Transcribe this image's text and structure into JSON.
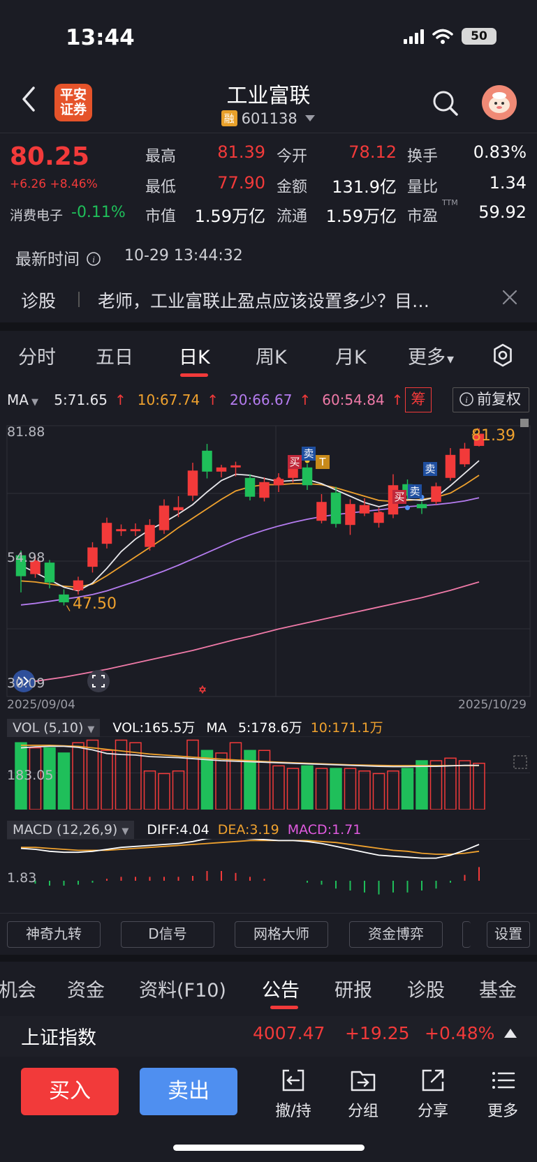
{
  "status_bar": {
    "time": "13:44",
    "battery": "50"
  },
  "header": {
    "broker_logo_text": "平安证券",
    "stock_name": "工业富联",
    "margin_badge": "融",
    "stock_code": "601138"
  },
  "quote": {
    "price": "80.25",
    "change": "+6.26 +8.46%",
    "sector_name": "消费电子",
    "sector_change": "-0.11%",
    "fields": [
      {
        "label": "最高",
        "value": "81.39",
        "color": "#f23a3a"
      },
      {
        "label": "今开",
        "value": "78.12",
        "color": "#f23a3a"
      },
      {
        "label": "换手",
        "value": "0.83%",
        "color": "#ffffff"
      },
      {
        "label": "最低",
        "value": "77.90",
        "color": "#f23a3a"
      },
      {
        "label": "金额",
        "value": "131.9亿",
        "color": "#ffffff"
      },
      {
        "label": "量比",
        "value": "1.34",
        "color": "#ffffff"
      },
      {
        "label": "市值",
        "value": "1.59万亿",
        "color": "#ffffff"
      },
      {
        "label": "流通",
        "value": "1.59万亿",
        "color": "#ffffff"
      },
      {
        "label": "市盈",
        "value": "59.92",
        "color": "#ffffff",
        "superscript": "TTM"
      }
    ],
    "latest_time_label": "最新时间",
    "latest_time": "10-29 13:44:32"
  },
  "diagnosis": {
    "label": "诊股",
    "text": "老师，工业富联止盈点应该设置多少？目…"
  },
  "chart_tabs": [
    "分时",
    "五日",
    "日K",
    "周K",
    "月K",
    "更多"
  ],
  "active_chart_tab": "日K",
  "ma_legend": {
    "ma_label": "MA",
    "items": [
      {
        "text": "5:71.65",
        "color": "#e8e8ec"
      },
      {
        "text": "10:67.74",
        "color": "#f0a22e"
      },
      {
        "text": "20:66.67",
        "color": "#b57cf0"
      },
      {
        "text": "60:54.84",
        "color": "#f07aa8"
      }
    ],
    "chou": "筹",
    "fuquan": "前复权"
  },
  "kline": {
    "y_max_label": "81.88",
    "y_mid_label": "54.98",
    "y_min_label": "30.09",
    "low_marker": "47.50",
    "high_marker": "81.39",
    "date_start": "2025/09/04",
    "date_end": "2025/10/29",
    "signals": [
      {
        "text": "买",
        "color": "#c0283a"
      },
      {
        "text": "卖",
        "color": "#1f4fa0"
      },
      {
        "text": "T",
        "color": "#c88a1a"
      },
      {
        "text": "买",
        "color": "#c0283a"
      },
      {
        "text": "卖",
        "color": "#1f4fa0"
      },
      {
        "text": "卖",
        "color": "#1f4fa0"
      }
    ]
  },
  "chart_data": {
    "type": "candlestick",
    "ylim": [
      30.09,
      81.88
    ],
    "candles": [
      {
        "o": 57.0,
        "c": 53.2,
        "h": 58.0,
        "l": 50.0
      },
      {
        "o": 53.6,
        "c": 56.0,
        "h": 57.0,
        "l": 52.8
      },
      {
        "o": 55.6,
        "c": 52.0,
        "h": 56.2,
        "l": 50.8
      },
      {
        "o": 49.5,
        "c": 48.2,
        "h": 50.6,
        "l": 47.5
      },
      {
        "o": 50.5,
        "c": 52.2,
        "h": 53.0,
        "l": 49.6
      },
      {
        "o": 55.0,
        "c": 58.5,
        "h": 59.6,
        "l": 53.8
      },
      {
        "o": 59.4,
        "c": 63.2,
        "h": 64.3,
        "l": 58.4
      },
      {
        "o": 61.8,
        "c": 62.0,
        "h": 63.0,
        "l": 60.8
      },
      {
        "o": 61.8,
        "c": 62.0,
        "h": 63.2,
        "l": 60.8
      },
      {
        "o": 58.8,
        "c": 62.8,
        "h": 64.0,
        "l": 58.0
      },
      {
        "o": 62.0,
        "c": 66.5,
        "h": 67.8,
        "l": 61.2
      },
      {
        "o": 65.8,
        "c": 66.2,
        "h": 68.4,
        "l": 64.4
      },
      {
        "o": 68.6,
        "c": 73.2,
        "h": 74.8,
        "l": 67.5
      },
      {
        "o": 77.0,
        "c": 73.2,
        "h": 78.4,
        "l": 71.8
      },
      {
        "o": 73.2,
        "c": 73.8,
        "h": 74.4,
        "l": 72.0
      },
      {
        "o": 74.0,
        "c": 74.2,
        "h": 75.0,
        "l": 72.2
      },
      {
        "o": 71.8,
        "c": 68.4,
        "h": 72.6,
        "l": 67.6
      },
      {
        "o": 68.2,
        "c": 71.0,
        "h": 72.0,
        "l": 67.4
      },
      {
        "o": 70.6,
        "c": 71.6,
        "h": 72.8,
        "l": 69.2
      },
      {
        "o": 72.0,
        "c": 74.0,
        "h": 75.8,
        "l": 71.0
      },
      {
        "o": 73.8,
        "c": 70.6,
        "h": 74.6,
        "l": 69.6
      },
      {
        "o": 63.8,
        "c": 67.2,
        "h": 68.8,
        "l": 63.2
      },
      {
        "o": 69.0,
        "c": 63.2,
        "h": 70.2,
        "l": 62.4
      },
      {
        "o": 63.0,
        "c": 66.8,
        "h": 67.8,
        "l": 61.0
      },
      {
        "o": 65.2,
        "c": 66.6,
        "h": 68.0,
        "l": 64.6
      },
      {
        "o": 63.4,
        "c": 65.2,
        "h": 66.2,
        "l": 62.4
      },
      {
        "o": 65.0,
        "c": 70.4,
        "h": 72.6,
        "l": 64.2
      },
      {
        "o": 70.6,
        "c": 68.6,
        "h": 71.6,
        "l": 67.8
      },
      {
        "o": 66.8,
        "c": 66.2,
        "h": 67.4,
        "l": 65.0
      },
      {
        "o": 67.4,
        "c": 70.2,
        "h": 71.0,
        "l": 66.8
      },
      {
        "o": 72.0,
        "c": 76.2,
        "h": 77.6,
        "l": 71.4
      },
      {
        "o": 74.6,
        "c": 77.4,
        "h": 78.6,
        "l": 74.0
      },
      {
        "o": 78.12,
        "c": 80.25,
        "h": 81.39,
        "l": 77.9
      }
    ],
    "ma5": [
      55.2,
      53.8,
      52.4,
      51.0,
      50.3,
      51.8,
      54.6,
      57.8,
      60.2,
      62.0,
      63.4,
      65.0,
      66.8,
      69.2,
      71.4,
      72.6,
      72.4,
      71.8,
      71.2,
      71.4,
      71.6,
      70.8,
      69.6,
      68.4,
      67.2,
      66.4,
      67.0,
      67.8,
      67.6,
      68.2,
      70.4,
      72.8,
      75.2
    ],
    "ma10": [
      52.2,
      52.0,
      51.6,
      51.2,
      51.0,
      51.6,
      53.2,
      55.0,
      56.8,
      58.6,
      60.4,
      62.4,
      64.2,
      66.0,
      67.8,
      69.4,
      70.2,
      70.6,
      70.6,
      70.8,
      70.8,
      70.6,
      70.0,
      69.2,
      68.4,
      67.6,
      67.4,
      67.6,
      67.8,
      68.2,
      69.0,
      70.6,
      72.4
    ],
    "ma20": [
      47.6,
      47.9,
      48.3,
      48.7,
      49.1,
      49.6,
      50.3,
      51.2,
      52.1,
      53.1,
      54.1,
      55.2,
      56.4,
      57.6,
      58.8,
      60.0,
      61.0,
      61.9,
      62.7,
      63.4,
      64.0,
      64.5,
      64.9,
      65.2,
      65.5,
      65.8,
      66.1,
      66.4,
      66.6,
      66.8,
      67.1,
      67.5,
      68.1
    ],
    "ma60": [
      32.6,
      33.0,
      33.4,
      33.8,
      34.3,
      34.8,
      35.3,
      35.9,
      36.5,
      37.1,
      37.7,
      38.3,
      38.9,
      39.6,
      40.3,
      41.0,
      41.6,
      42.3,
      43.0,
      43.6,
      44.2,
      44.8,
      45.4,
      46.0,
      46.6,
      47.2,
      47.8,
      48.4,
      49.0,
      49.7,
      50.4,
      51.2,
      52.0
    ]
  },
  "volume": {
    "box_label": "VOL (5,10)",
    "vol_text": "VOL:165.5万",
    "ma_label": "MA",
    "ma5_text": "5:178.6万",
    "ma10_text": "10:171.1万",
    "axis_label": "183.05",
    "bars": [
      260,
      240,
      240,
      220,
      260,
      270,
      230,
      270,
      260,
      150,
      140,
      150,
      270,
      230,
      220,
      260,
      230,
      230,
      170,
      160,
      170,
      160,
      160,
      160,
      150,
      140,
      150,
      160,
      190,
      190,
      200,
      190,
      180
    ],
    "ma5": [
      240,
      244,
      246,
      246,
      242,
      232,
      218,
      214,
      212,
      206,
      204,
      202,
      198,
      194,
      190,
      188,
      186,
      184,
      182,
      180,
      178,
      176,
      174,
      172,
      170,
      168,
      167,
      167,
      168,
      168,
      170,
      172,
      172
    ],
    "ma10": [
      250,
      250,
      250,
      248,
      246,
      240,
      234,
      228,
      222,
      216,
      212,
      208,
      204,
      200,
      196,
      193,
      190,
      187,
      184,
      182,
      180,
      178,
      176,
      174,
      173,
      172,
      171,
      171,
      171,
      171,
      171,
      171,
      171
    ]
  },
  "macd": {
    "box_label": "MACD (12,26,9)",
    "diff_text": "DIFF:4.04",
    "dea_text": "DEA:3.19",
    "macd_text": "MACD:1.71",
    "axis_label": "1.83",
    "diff": [
      2.6,
      2.5,
      2.3,
      2.2,
      2.2,
      2.3,
      2.5,
      2.7,
      2.8,
      2.9,
      3.0,
      3.1,
      3.3,
      3.6,
      3.7,
      3.7,
      3.6,
      3.5,
      3.4,
      3.4,
      3.3,
      3.1,
      2.8,
      2.5,
      2.2,
      1.9,
      1.8,
      1.7,
      1.6,
      1.6,
      1.9,
      2.4,
      3.0
    ],
    "dea": [
      2.7,
      2.7,
      2.6,
      2.5,
      2.4,
      2.4,
      2.4,
      2.5,
      2.6,
      2.7,
      2.8,
      2.9,
      3.0,
      3.1,
      3.2,
      3.3,
      3.4,
      3.4,
      3.4,
      3.4,
      3.4,
      3.3,
      3.2,
      3.0,
      2.8,
      2.6,
      2.4,
      2.3,
      2.1,
      2.0,
      2.0,
      2.1,
      2.3
    ],
    "hist": [
      0.0,
      -0.3,
      -0.5,
      -0.5,
      -0.4,
      -0.2,
      0.2,
      0.4,
      0.4,
      0.4,
      0.4,
      0.4,
      0.5,
      1.0,
      1.0,
      0.8,
      0.4,
      0.2,
      0.0,
      0.0,
      -0.2,
      -0.4,
      -0.8,
      -1.0,
      -1.2,
      -1.4,
      -1.2,
      -1.2,
      -1.0,
      -0.8,
      -0.2,
      0.6,
      1.4
    ]
  },
  "tools": [
    "神奇九转",
    "D信号",
    "网格大师",
    "资金博弈",
    "设置"
  ],
  "info_tabs": [
    "机会",
    "资金",
    "资料(F10)",
    "公告",
    "研报",
    "诊股",
    "基金"
  ],
  "active_info_tab": "公告",
  "index_bar": {
    "name": "上证指数",
    "value": "4007.47",
    "change": "+19.25",
    "pct": "+0.48%"
  },
  "bottom_bar": {
    "buy": "买入",
    "sell": "卖出",
    "items": [
      "撤/持",
      "分组",
      "分享",
      "更多"
    ]
  }
}
